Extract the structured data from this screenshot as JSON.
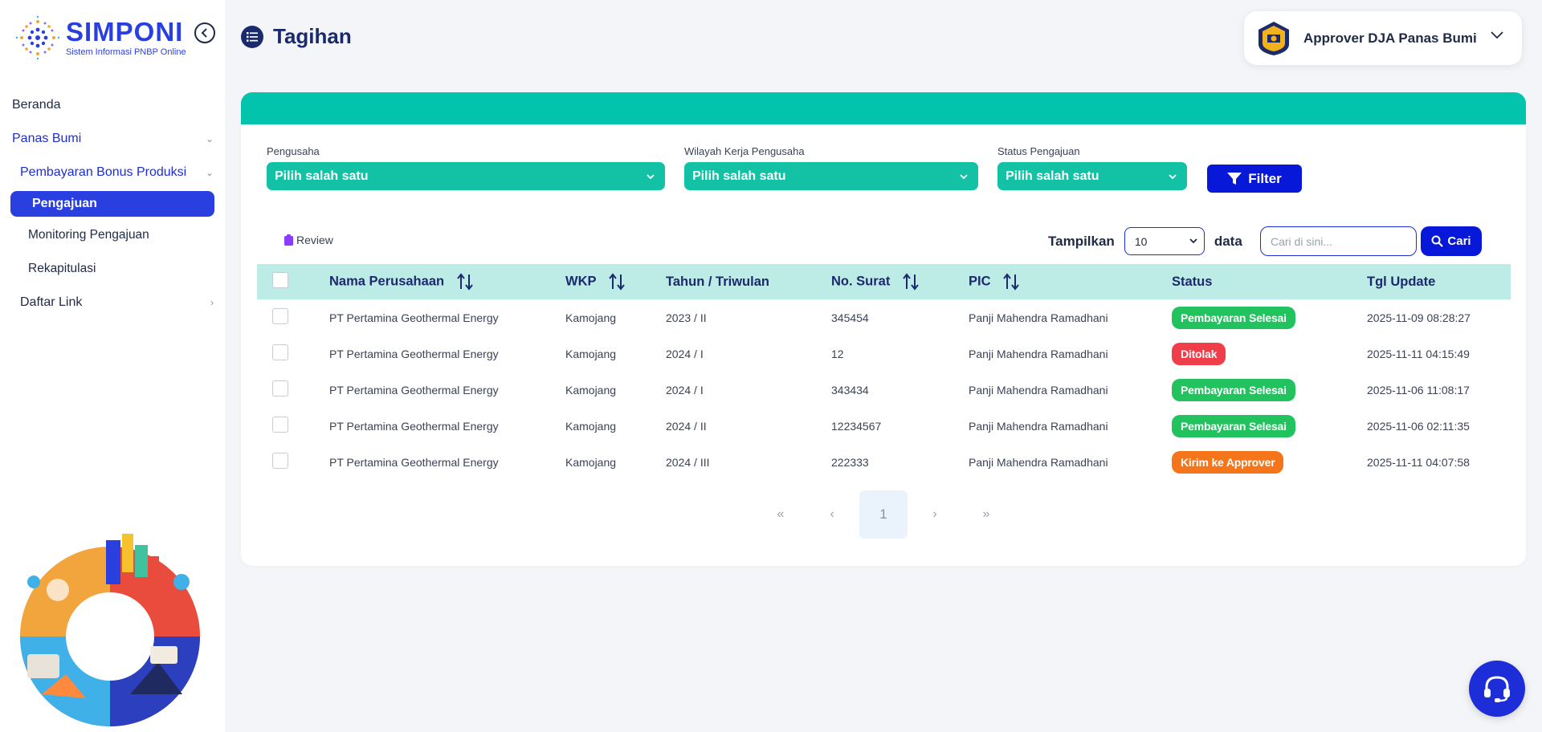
{
  "brand": {
    "name": "SIMPONI",
    "subtitle": "Sistem Informasi PNBP Online"
  },
  "sidebar": {
    "items": [
      {
        "label": "Beranda"
      },
      {
        "label": "Panas Bumi"
      },
      {
        "label": "Pembayaran Bonus Produksi"
      },
      {
        "label": "Pengajuan"
      },
      {
        "label": "Monitoring Pengajuan"
      },
      {
        "label": "Rekapitulasi"
      },
      {
        "label": "Daftar Link"
      }
    ]
  },
  "header": {
    "title": "Tagihan",
    "user": "Approver DJA Panas Bumi"
  },
  "filters": {
    "pengusaha": {
      "label": "Pengusaha",
      "value": "Pilih salah satu"
    },
    "wkp": {
      "label": "Wilayah Kerja Pengusaha",
      "value": "Pilih salah satu"
    },
    "status": {
      "label": "Status Pengajuan",
      "value": "Pilih salah satu"
    },
    "button": "Filter"
  },
  "toolbar": {
    "review": "Review",
    "show_label": "Tampilkan",
    "show_value": "10",
    "show_suffix": "data",
    "search_placeholder": "Cari di sini...",
    "search_button": "Cari"
  },
  "table": {
    "columns": [
      "Nama Perusahaan",
      "WKP",
      "Tahun / Triwulan",
      "No. Surat",
      "PIC",
      "Status",
      "Tgl Update"
    ],
    "rows": [
      {
        "company": "PT Pertamina Geothermal Energy",
        "wkp": "Kamojang",
        "period": "2023 / II",
        "letter": "345454",
        "pic": "Panji Mahendra Ramadhani",
        "status": "Pembayaran Selesai",
        "status_color": "#22c35e",
        "updated": "2025-11-09 08:28:27"
      },
      {
        "company": "PT Pertamina Geothermal Energy",
        "wkp": "Kamojang",
        "period": "2024 / I",
        "letter": "12",
        "pic": "Panji Mahendra Ramadhani",
        "status": "Ditolak",
        "status_color": "#ef3e4a",
        "updated": "2025-11-11 04:15:49"
      },
      {
        "company": "PT Pertamina Geothermal Energy",
        "wkp": "Kamojang",
        "period": "2024 / I",
        "letter": "343434",
        "pic": "Panji Mahendra Ramadhani",
        "status": "Pembayaran Selesai",
        "status_color": "#22c35e",
        "updated": "2025-11-06 11:08:17"
      },
      {
        "company": "PT Pertamina Geothermal Energy",
        "wkp": "Kamojang",
        "period": "2024 / II",
        "letter": "12234567",
        "pic": "Panji Mahendra Ramadhani",
        "status": "Pembayaran Selesai",
        "status_color": "#22c35e",
        "updated": "2025-11-06 02:11:35"
      },
      {
        "company": "PT Pertamina Geothermal Energy",
        "wkp": "Kamojang",
        "period": "2024 / III",
        "letter": "222333",
        "pic": "Panji Mahendra Ramadhani",
        "status": "Kirim ke Approver",
        "status_color": "#f5761a",
        "updated": "2025-11-11 04:07:58"
      }
    ]
  },
  "pagination": {
    "first": "«",
    "prev": "‹",
    "current": "1",
    "next": "›",
    "last": "»"
  },
  "colors": {
    "accent": "#02c4ad",
    "primary": "#1d2dd8",
    "brand_navy": "#1a2a6c"
  }
}
